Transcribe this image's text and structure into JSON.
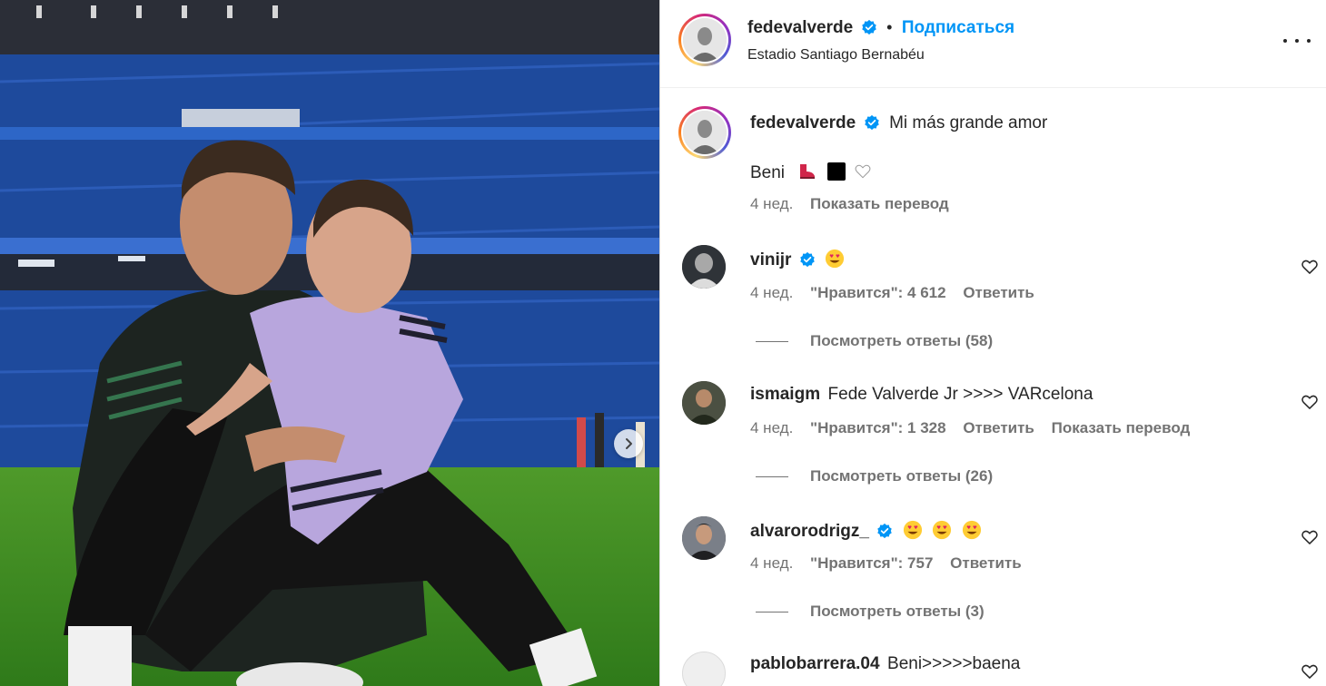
{
  "post": {
    "author": "fedevalverde",
    "follow_label": "Подписаться",
    "separator": "•",
    "location": "Estadio Santiago Bernabéu"
  },
  "caption": {
    "author": "fedevalverde",
    "text": "Mi más grande amor",
    "second_line": "Beni",
    "time": "4 нед.",
    "translate_label": "Показать перевод"
  },
  "comments": [
    {
      "username": "vinijr",
      "verified": true,
      "text": "",
      "emoji": [
        "smiling-face-with-heart-eyes"
      ],
      "time": "4 нед.",
      "likes": "\"Нравится\": 4 612",
      "reply_label": "Ответить",
      "translate_label": "",
      "view_replies": "Посмотреть ответы (58)"
    },
    {
      "username": "ismaigm",
      "verified": false,
      "text": "Fede Valverde Jr >>>> VARcelona",
      "emoji": [],
      "time": "4 нед.",
      "likes": "\"Нравится\": 1 328",
      "reply_label": "Ответить",
      "translate_label": "Показать перевод",
      "view_replies": "Посмотреть ответы (26)"
    },
    {
      "username": "alvarorodrigz_",
      "verified": true,
      "text": "",
      "emoji": [
        "smiling-face-with-heart-eyes",
        "smiling-face-with-heart-eyes",
        "smiling-face-with-heart-eyes"
      ],
      "time": "4 нед.",
      "likes": "\"Нравится\": 757",
      "reply_label": "Ответить",
      "translate_label": "",
      "view_replies": "Посмотреть ответы (3)"
    },
    {
      "username": "pablobarrera.04",
      "verified": false,
      "text": "Beni>>>>>baena",
      "emoji": [],
      "time": "",
      "likes": "",
      "reply_label": "",
      "translate_label": "",
      "view_replies": ""
    }
  ],
  "colors": {
    "accent": "#0095f6",
    "verified": "#0095f6",
    "secondary_text": "#737373",
    "border": "#dbdbdb"
  },
  "icons": [
    "verified-badge-icon",
    "more-options-icon",
    "heart-outline-icon",
    "next-arrow-icon"
  ]
}
